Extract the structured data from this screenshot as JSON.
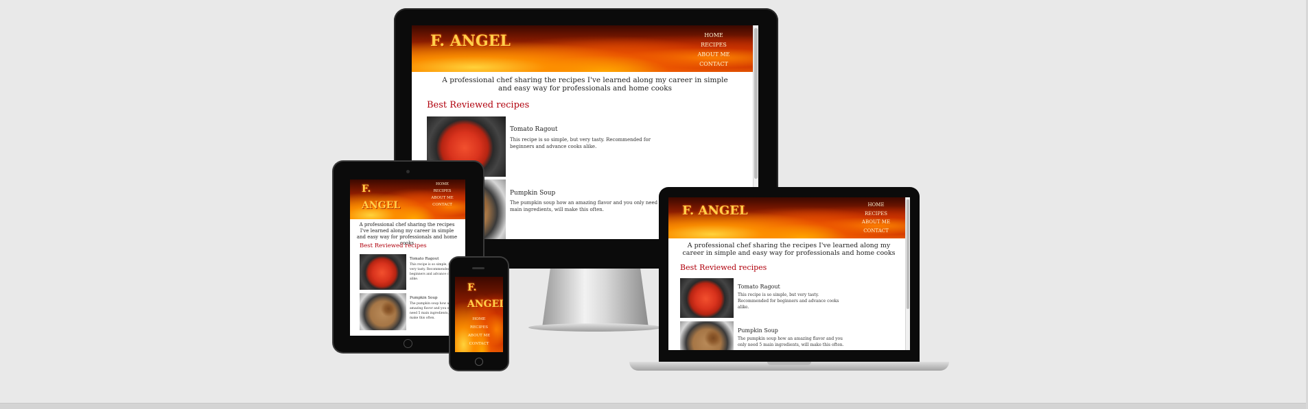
{
  "site": {
    "logo": "F. ANGEL",
    "logo_line1": "F.",
    "logo_line2": "ANGEL",
    "nav": [
      "HOME",
      "RECIPES",
      "ABOUT ME",
      "CONTACT"
    ],
    "tagline": "A professional chef sharing the recipes I've learned along my career in simple and easy way for professionals and home cooks",
    "section_title": "Best Reviewed recipes",
    "recipes": [
      {
        "name": "Tomato Ragout",
        "description": "This recipe is so simple, but very tasty. Recommended for beginners and advance cooks alike.",
        "image": "tomato-ragout-photo"
      },
      {
        "name": "Pumpkin Soup",
        "description": "The pumpkin soup how an amazing flavor and you only need 5 main ingredients, will make this often.",
        "image": "pumpkin-soup-photo"
      }
    ]
  },
  "devices": [
    "desktop-monitor",
    "tablet",
    "laptop",
    "phone"
  ],
  "colors": {
    "background": "#e9e9e9",
    "section_title": "#b0000c",
    "logo": "#ffcf4a",
    "device_bezel": "#0b0b0b"
  }
}
